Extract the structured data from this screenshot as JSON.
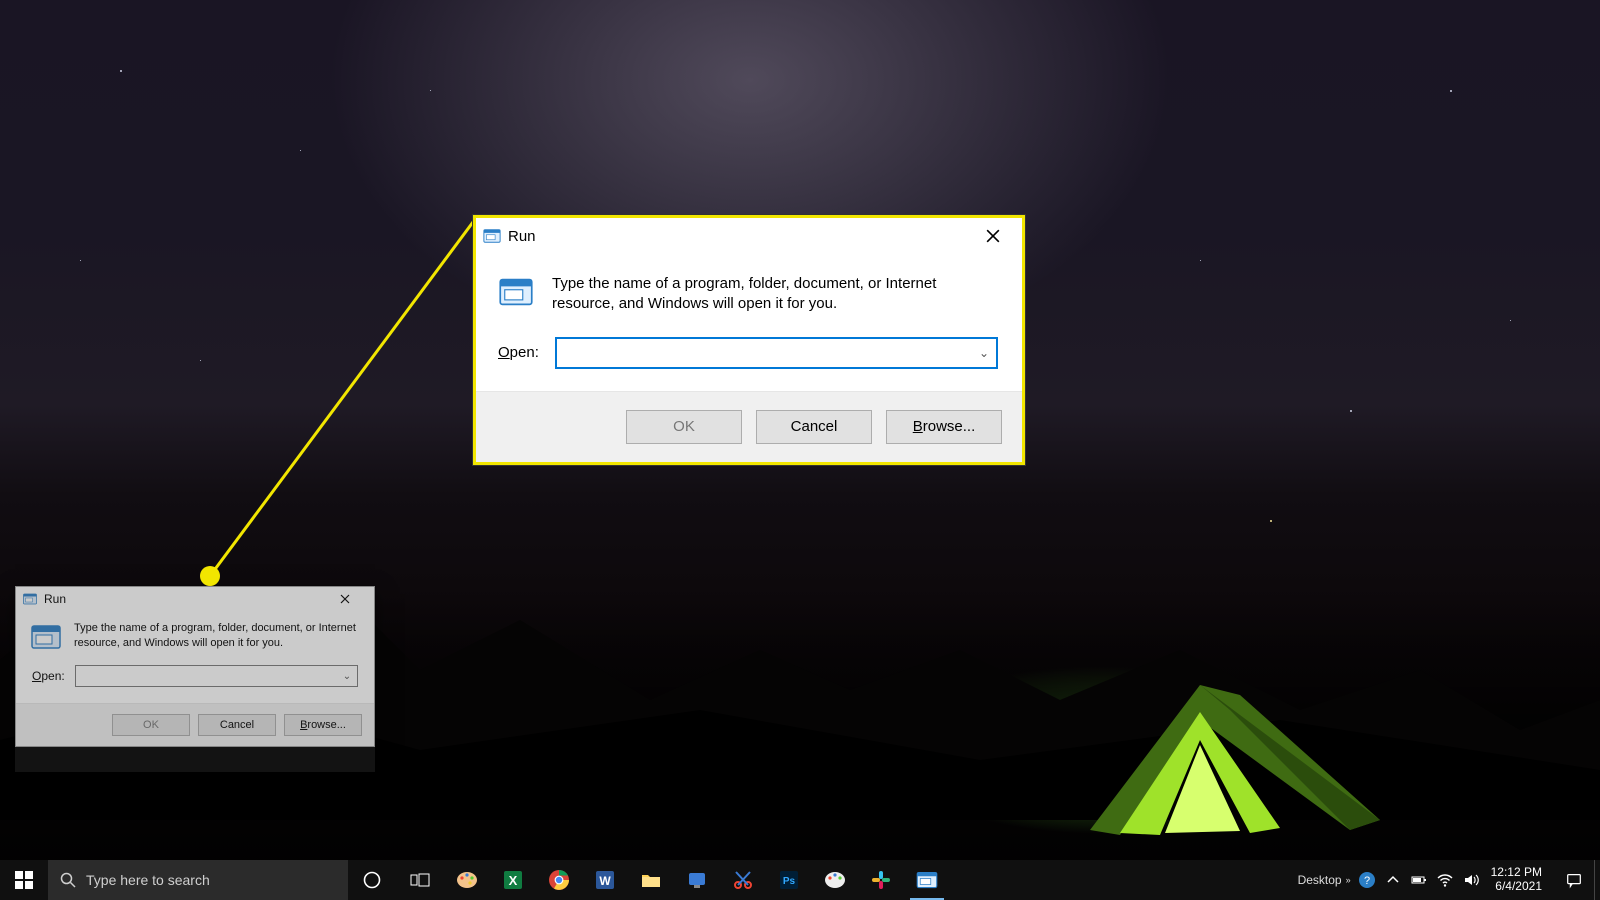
{
  "run_dialog": {
    "title": "Run",
    "description": "Type the name of a program, folder, document, or Internet resource, and Windows will open it for you.",
    "open_label_prefix": "O",
    "open_label_rest": "pen:",
    "input_value": "",
    "input_placeholder": "",
    "chevron_glyph": "⌄",
    "buttons": {
      "ok": "OK",
      "cancel": "Cancel",
      "browse_prefix": "B",
      "browse_rest": "rowse..."
    }
  },
  "taskbar": {
    "search_placeholder": "Type here to search",
    "desktop_toolbar_label": "Desktop",
    "clock_time": "12:12 PM",
    "clock_date": "6/4/2021",
    "app_icons": [
      "paint-legacy-icon",
      "excel-icon",
      "chrome-icon",
      "word-icon",
      "file-explorer-icon",
      "assist-icon",
      "snip-icon",
      "photoshop-icon",
      "paint-icon",
      "slack-icon",
      "run-window-icon"
    ],
    "active_app_index": 10,
    "tray_icons": [
      "help-icon",
      "chevron-up-icon",
      "battery-icon",
      "wifi-icon",
      "volume-icon"
    ]
  },
  "colors": {
    "highlight": "#f2e600",
    "win_blue": "#0078d7"
  }
}
